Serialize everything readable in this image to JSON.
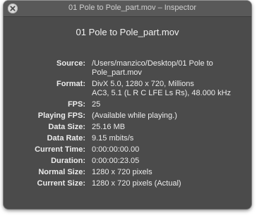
{
  "window": {
    "title": "01 Pole to Pole_part.mov – Inspector",
    "close_icon": "close-icon"
  },
  "file_name": "01 Pole to Pole_part.mov",
  "properties": [
    {
      "label": "Source:",
      "lines": [
        "/Users/manzico/Desktop/01 Pole to",
        "Pole_part.mov"
      ]
    },
    {
      "label": "Format:",
      "lines": [
        "DivX 5.0, 1280 x 720, Millions",
        "AC3, 5.1 (L R C LFE Ls Rs), 48.000 kHz"
      ]
    },
    {
      "label": "FPS:",
      "lines": [
        "25"
      ]
    },
    {
      "label": "Playing FPS:",
      "lines": [
        "(Available while playing.)"
      ]
    },
    {
      "label": "Data Size:",
      "lines": [
        "25.16 MB"
      ]
    },
    {
      "label": "Data Rate:",
      "lines": [
        "9.15 mbits/s"
      ]
    },
    {
      "label": "Current Time:",
      "lines": [
        "0:00:00:00.00"
      ]
    },
    {
      "label": "Duration:",
      "lines": [
        "0:00:00:23.05"
      ]
    },
    {
      "label": "Normal Size:",
      "lines": [
        "1280 x 720 pixels"
      ]
    },
    {
      "label": "Current Size:",
      "lines": [
        "1280 x 720 pixels (Actual)"
      ]
    }
  ],
  "colors": {
    "panel_background": "#4b4b4b",
    "titlebar_background": "#595959",
    "text": "#ececec"
  }
}
